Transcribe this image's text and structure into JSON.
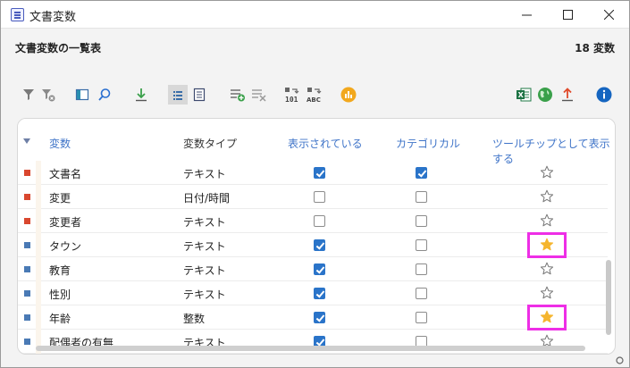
{
  "window": {
    "title": "文書変数"
  },
  "header": {
    "title": "文書変数の一覧表",
    "count": "18 変数"
  },
  "toolbar": {
    "icons": [
      "filter-icon",
      "clear-filter-icon",
      "columns-icon",
      "search-icon",
      "download-icon",
      "list-view-icon",
      "detail-view-icon",
      "add-variable-icon",
      "remove-variable-icon",
      "numeric-conversion-icon",
      "text-conversion-icon",
      "statistics-icon",
      "excel-icon",
      "web-icon",
      "export-icon",
      "info-icon"
    ]
  },
  "table": {
    "headers": {
      "variable": "変数",
      "type": "変数タイプ",
      "visible": "表示されている",
      "categorical": "カテゴリカル",
      "tooltip": "ツールチップとして表示する"
    },
    "rows": [
      {
        "name": "文書名",
        "type": "テキスト",
        "visible": true,
        "categorical": true,
        "tooltip": false,
        "marker_color": "#d9472f",
        "highlighted": false
      },
      {
        "name": "変更",
        "type": "日付/時間",
        "visible": false,
        "categorical": false,
        "tooltip": false,
        "marker_color": "#d9472f",
        "highlighted": false
      },
      {
        "name": "変更者",
        "type": "テキスト",
        "visible": false,
        "categorical": false,
        "tooltip": false,
        "marker_color": "#d9472f",
        "highlighted": false
      },
      {
        "name": "タウン",
        "type": "テキスト",
        "visible": true,
        "categorical": false,
        "tooltip": true,
        "marker_color": "#4a7ab5",
        "highlighted": true
      },
      {
        "name": "教育",
        "type": "テキスト",
        "visible": true,
        "categorical": false,
        "tooltip": false,
        "marker_color": "#4a7ab5",
        "highlighted": false
      },
      {
        "name": "性別",
        "type": "テキスト",
        "visible": true,
        "categorical": false,
        "tooltip": false,
        "marker_color": "#4a7ab5",
        "highlighted": false
      },
      {
        "name": "年齢",
        "type": "整数",
        "visible": true,
        "categorical": false,
        "tooltip": true,
        "marker_color": "#4a7ab5",
        "highlighted": true
      },
      {
        "name": "配偶者の有無",
        "type": "テキスト",
        "visible": true,
        "categorical": false,
        "tooltip": false,
        "marker_color": "#4a7ab5",
        "highlighted": false
      }
    ]
  },
  "colors": {
    "accent_blue": "#3f74c8",
    "checkbox_blue": "#2a74c9",
    "star_gold": "#f5b52e",
    "highlight_magenta": "#ee2ee6"
  }
}
